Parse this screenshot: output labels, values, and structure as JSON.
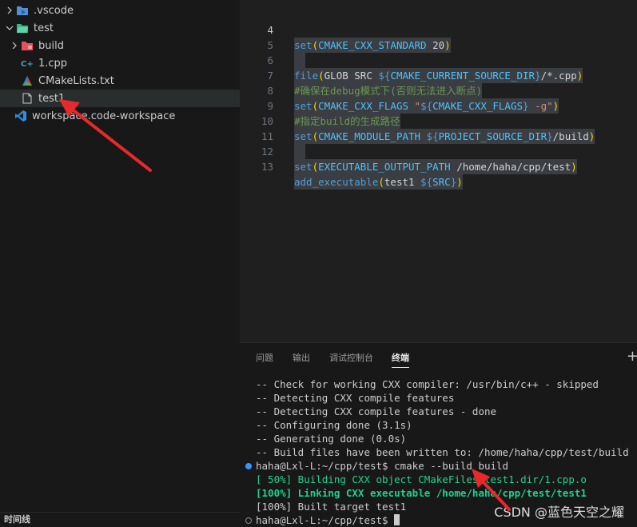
{
  "sidebar": {
    "items": [
      {
        "label": ".vscode",
        "icon": "vscode-folder-icon",
        "expanded": false
      },
      {
        "label": "test",
        "icon": "folder-open-icon",
        "expanded": true
      },
      {
        "label": "build",
        "icon": "build-folder-icon",
        "expanded": false
      },
      {
        "label": "1.cpp",
        "icon": "cpp-file-icon"
      },
      {
        "label": "CMakeLists.txt",
        "icon": "cmake-file-icon"
      },
      {
        "label": "test1",
        "icon": "file-icon"
      },
      {
        "label": "workspace.code-workspace",
        "icon": "vscode-file-icon"
      }
    ],
    "timeline_label": "时间线"
  },
  "editor": {
    "lines": [
      {
        "n": "4",
        "text": "set(CMAKE_CXX_STANDARD 20)"
      },
      {
        "n": "5",
        "text": ""
      },
      {
        "n": "6",
        "text": "file(GLOB SRC ${CMAKE_CURRENT_SOURCE_DIR}/*.cpp)"
      },
      {
        "n": "7",
        "text": "#确保在debug模式下(否则无法进入断点)"
      },
      {
        "n": "8",
        "text": "set(CMAKE_CXX_FLAGS \"${CMAKE_CXX_FLAGS} -g\")"
      },
      {
        "n": "9",
        "text": "#指定build的生成路径"
      },
      {
        "n": "10",
        "text": "set(CMAKE_MODULE_PATH ${PROJECT_SOURCE_DIR}/build)"
      },
      {
        "n": "11",
        "text": ""
      },
      {
        "n": "12",
        "text": "set(EXECUTABLE_OUTPUT_PATH /home/haha/cpp/test)"
      },
      {
        "n": "13",
        "text": "add_executable(test1 ${SRC})"
      }
    ]
  },
  "panel": {
    "tabs": [
      "问题",
      "输出",
      "调试控制台",
      "终端"
    ],
    "active_tab": "终端",
    "terminal": [
      "-- Check for working CXX compiler: /usr/bin/c++ - skipped",
      "-- Detecting CXX compile features",
      "-- Detecting CXX compile features - done",
      "-- Configuring done (3.1s)",
      "-- Generating done (0.0s)",
      "-- Build files have been written to: /home/haha/cpp/test/build",
      "haha@Lxl-L:~/cpp/test$ cmake --build build",
      "[ 50%] Building CXX object CMakeFiles/test1.dir/1.cpp.o",
      "[100%] Linking CXX executable /home/haha/cpp/test/test1",
      "[100%] Built target test1",
      "haha@Lxl-L:~/cpp/test$ "
    ]
  },
  "watermark": "CSDN @蓝色天空之耀",
  "colors": {
    "keyword": "#569cd6",
    "comment": "#6a9955",
    "string": "#ce9178",
    "green": "#23d18b",
    "annotation_arrow": "#e8282a"
  }
}
